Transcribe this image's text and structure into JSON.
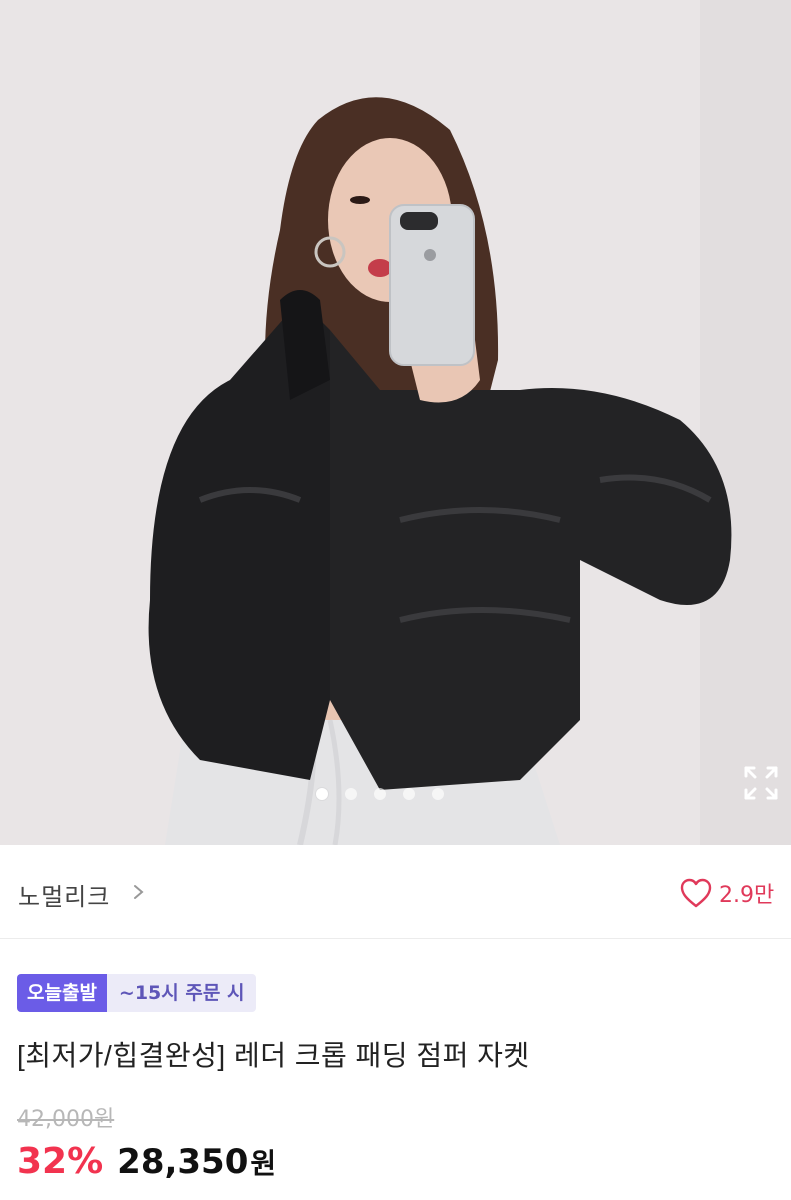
{
  "product": {
    "brand": "노멀리크",
    "like_count": "2.9만",
    "tag_today": "오늘출발",
    "tag_order": "~15시 주문 시",
    "title": "[최저가/힙결완성] 레더 크롭 패딩 점퍼 자켓",
    "original_price": "42,000원",
    "discount": "32%",
    "sale_price": "28,350",
    "currency": "원"
  },
  "gallery": {
    "slide_count": 5,
    "active_slide": 1
  },
  "icons": {
    "brand_chevron": "chevron-right-icon",
    "like": "heart-outline-icon",
    "expand": "expand-icon"
  },
  "colors": {
    "accent_red": "#f2334f",
    "heart": "#e0395a",
    "tag_purple": "#6b5ce7",
    "tag_light": "#ecebf8"
  }
}
